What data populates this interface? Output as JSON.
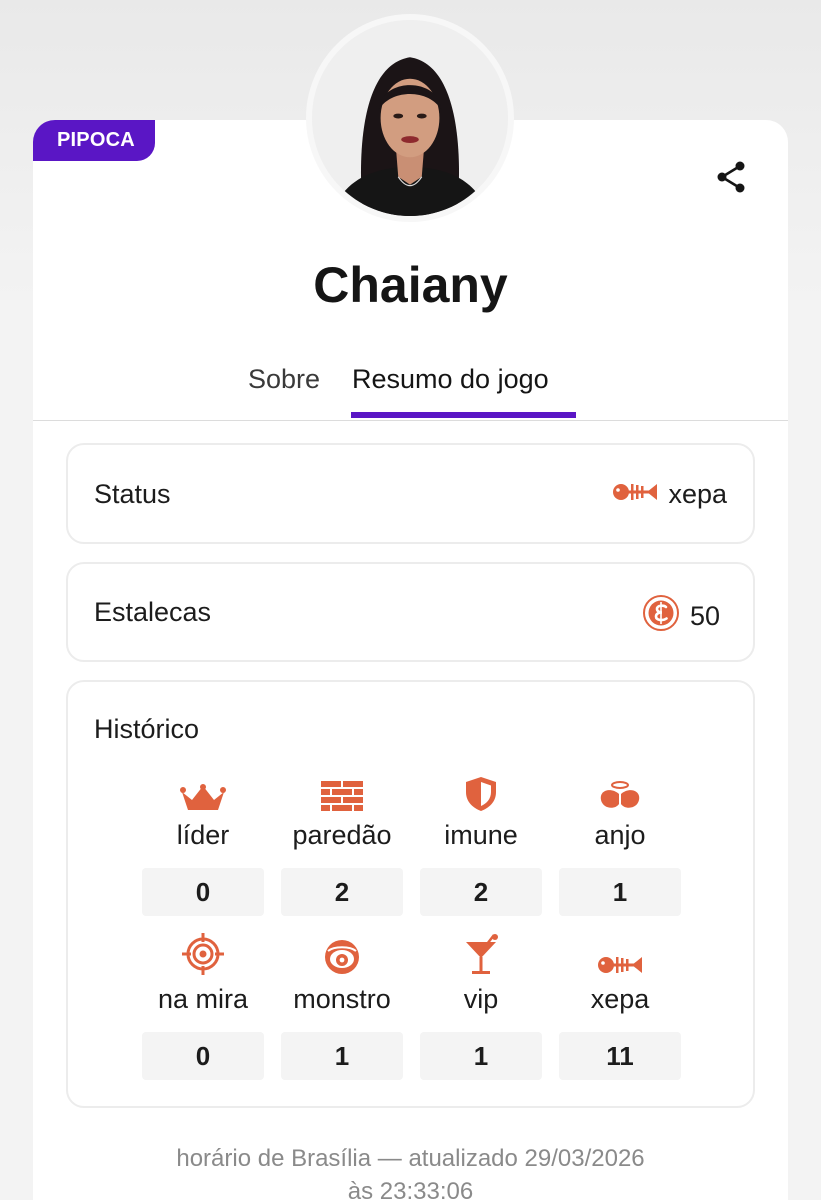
{
  "profile": {
    "badge": "PIPOCA",
    "name": "Chaiany",
    "avatar_icon": "participant-photo",
    "share_icon": "share-icon"
  },
  "tabs": [
    {
      "label": "Sobre",
      "active": false
    },
    {
      "label": "Resumo do jogo",
      "active": true
    }
  ],
  "status": {
    "label": "Status",
    "value": "xepa",
    "icon": "fish-bone-icon"
  },
  "estalecas": {
    "label": "Estalecas",
    "value": "50",
    "icon": "estaleca-coin-icon"
  },
  "historico": {
    "title": "Histórico",
    "items": [
      {
        "label": "líder",
        "count": "0",
        "icon": "crown-icon"
      },
      {
        "label": "paredão",
        "count": "2",
        "icon": "brick-wall-icon"
      },
      {
        "label": "imune",
        "count": "2",
        "icon": "shield-icon"
      },
      {
        "label": "anjo",
        "count": "1",
        "icon": "angel-wings-icon"
      },
      {
        "label": "na mira",
        "count": "0",
        "icon": "target-icon"
      },
      {
        "label": "monstro",
        "count": "1",
        "icon": "monster-eye-icon"
      },
      {
        "label": "vip",
        "count": "1",
        "icon": "cocktail-icon"
      },
      {
        "label": "xepa",
        "count": "11",
        "icon": "fish-bone-icon"
      }
    ]
  },
  "footer": {
    "line1": "horário de Brasília — atualizado 29/03/2026",
    "line2": "às 23:33:06"
  },
  "colors": {
    "accent": "#5a16c5",
    "icon": "#e0623e"
  }
}
